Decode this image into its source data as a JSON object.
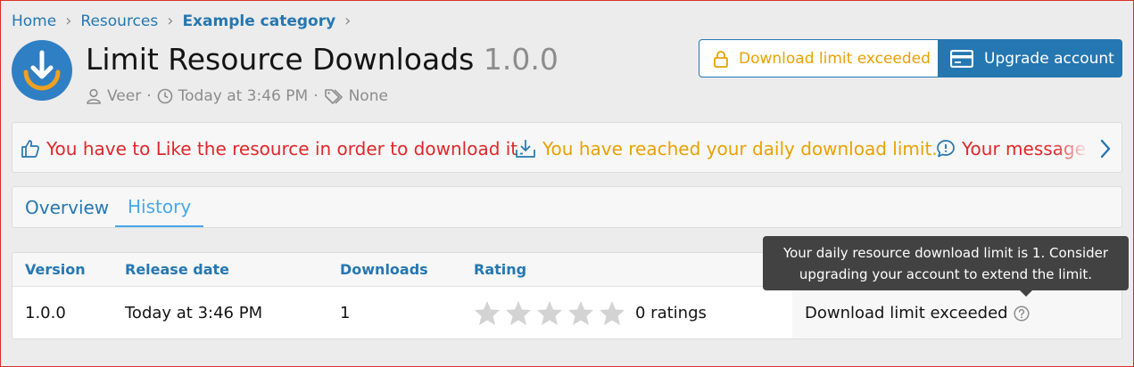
{
  "breadcrumb": {
    "items": [
      "Home",
      "Resources",
      "Example category"
    ]
  },
  "resource": {
    "title": "Limit Resource Downloads",
    "version": "1.0.0",
    "author": "Veer",
    "date": "Today at 3:46 PM",
    "tags": "None"
  },
  "actions": {
    "limit_label": "Download limit exceeded",
    "upgrade_label": "Upgrade account"
  },
  "notices": [
    {
      "text": "You have to Like the resource in order to download it",
      "icon": "thumbs-up-icon"
    },
    {
      "text": "You have reached your daily download limit.",
      "icon": "download-box-icon"
    },
    {
      "text": "Your message cannot be shown in full",
      "icon": "message-alert-icon"
    }
  ],
  "tabs": [
    {
      "label": "Overview"
    },
    {
      "label": "History"
    }
  ],
  "table": {
    "headers": [
      "Version",
      "Release date",
      "Downloads",
      "Rating"
    ],
    "rows": [
      {
        "version": "1.0.0",
        "release_date": "Today at 3:46 PM",
        "downloads": "1",
        "rating_text": "0 ratings",
        "stars": 0,
        "download_status": "Download limit exceeded"
      }
    ]
  },
  "tooltip": {
    "line1": "Your daily resource download limit is 1. Consider",
    "line2": "upgrading your account to extend the limit."
  },
  "colors": {
    "link": "#2577b1",
    "accent": "#47a7eb",
    "warning": "#e9a100",
    "error": "#e0272b"
  }
}
